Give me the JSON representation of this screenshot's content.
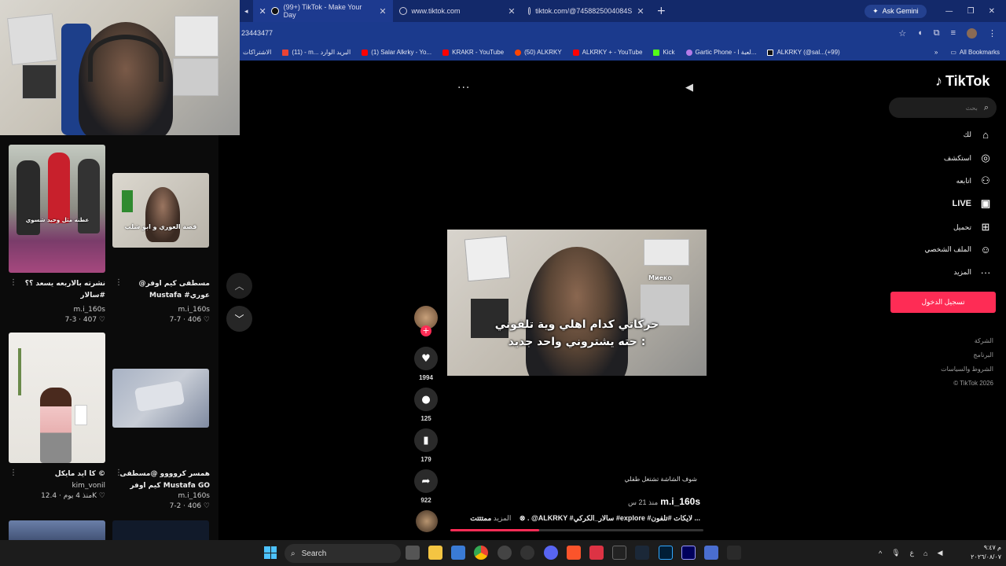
{
  "browser": {
    "tabs": [
      {
        "label": "(99+) TikTok - Make Your Day",
        "active": true
      },
      {
        "label": "www.tiktok.com",
        "active": false
      },
      {
        "label": "tiktok.com/@7458825004084S",
        "active": false
      }
    ],
    "new_tab_symbol": "+",
    "ask_gemini": "Ask Gemini",
    "url": "23443477",
    "bookmarks": [
      {
        "label": "الاشتراكات",
        "icon": "youtube-icon"
      },
      {
        "label": "(11) - m... البريد الوارد",
        "icon": "gmail-icon"
      },
      {
        "label": "(1) Salar Alkrky - Yo...",
        "icon": "youtube-icon"
      },
      {
        "label": "KRAKR - YouTube",
        "icon": "youtube-icon"
      },
      {
        "label": "(50) ALKRKY",
        "icon": "reddit-icon"
      },
      {
        "label": "ALKRKY + - YouTube",
        "icon": "youtube-icon"
      },
      {
        "label": "Kick",
        "icon": "kick-icon"
      },
      {
        "label": "Gartic Phone - لعبة ا...",
        "icon": "gartic-icon"
      },
      {
        "label": "ALKRKY (@sal...(+99)",
        "icon": "tiktok-icon"
      }
    ],
    "all_bookmarks": "All Bookmarks"
  },
  "feed": {
    "cards": [
      {
        "thumb_text": "عطنه مثل وحيد شسوي",
        "caption": "نشرته بالاربعه يسعد ؟؟ #سالار #مسطفى_كيم_اوفر #يورو...",
        "author": "m.i_160s",
        "stats": "7-3 · 407 ♡"
      },
      {
        "thumb_text": "قصة العوري و ابو شلب",
        "caption": "@مسطفى كيم اوفر Mustafa #عوري #ابو_شلب... GO",
        "author": "m.i_160s",
        "stats": "7-7 · 406 ♡"
      },
      {
        "thumb_text": "",
        "caption": "كا ايد مايكل ©",
        "author": "kim_vonil",
        "stats": "منذ 4 يوم · 12.4K ♡"
      },
      {
        "thumb_text": "",
        "caption": "همسر كروووو @مسطفى كيم اوفر Mustafa GO @BERO...",
        "author": "m.i_160s",
        "stats": "7-2 · 406 ♡"
      }
    ]
  },
  "video": {
    "subtitle_line1": "حركاتي كدام اهلي وية تلفوني",
    "subtitle_line2": "حته يشتروني واحد جديد :",
    "watermark": "Миеко",
    "more_dots": "···",
    "screen_text": "شوف الشاشة تشتغل طفلي",
    "author": "m.i_160s",
    "time_ago": "منذ 21 س",
    "description": "ممتتتت ⊗ . @ALKRKY #سالار_الكركي #explore #لايكات #تلفون ...",
    "more_label": "المزيد",
    "progress": 0.35,
    "likes": "1994",
    "comments": "125",
    "saves": "179",
    "shares": "922",
    "follow_symbol": "+"
  },
  "sidebar": {
    "logo": "TikTok",
    "search_placeholder": "بحث",
    "items": [
      {
        "label": "لك",
        "icon": "home-icon"
      },
      {
        "label": "استكشف",
        "icon": "compass-icon"
      },
      {
        "label": "اتابعه",
        "icon": "following-icon"
      },
      {
        "label": "LIVE",
        "icon": "live-icon"
      },
      {
        "label": "تحميل",
        "icon": "upload-icon"
      },
      {
        "label": "الملف الشخصي",
        "icon": "profile-icon"
      },
      {
        "label": "المزيد",
        "icon": "more-icon"
      }
    ],
    "login": "تسجيل الدخول",
    "footer": [
      "الشركة",
      "البرنامج",
      "الشروط والسياسات",
      "© TikTok 2026"
    ]
  },
  "taskbar": {
    "search_label": "Search",
    "clock_time": "م ٩:٤٧",
    "clock_date": "٢٠٢٦/٠٨/٠٧",
    "lang": "ع"
  },
  "colors": {
    "accent": "#fe2c55",
    "chrome": "#1b3a8d"
  }
}
